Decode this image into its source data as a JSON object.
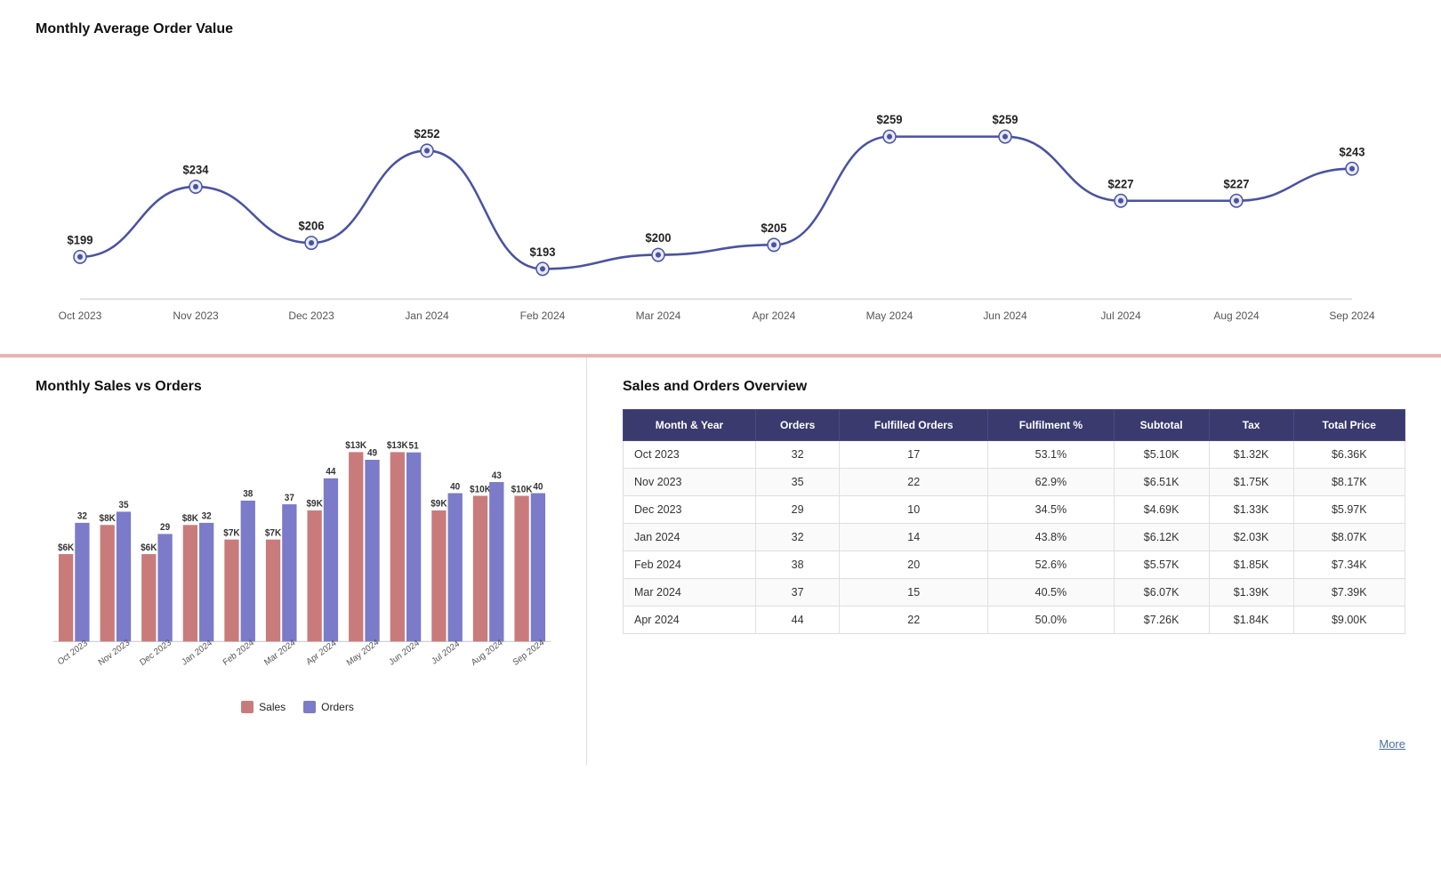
{
  "topChart": {
    "title": "Monthly Average Order Value",
    "data": [
      {
        "label": "Oct 2023",
        "value": 199
      },
      {
        "label": "Nov 2023",
        "value": 234
      },
      {
        "label": "Dec 2023",
        "value": 206
      },
      {
        "label": "Jan 2024",
        "value": 252
      },
      {
        "label": "Feb 2024",
        "value": 193
      },
      {
        "label": "Mar 2024",
        "value": 200
      },
      {
        "label": "Apr 2024",
        "value": 205
      },
      {
        "label": "May 2024",
        "value": 259
      },
      {
        "label": "Jun 2024",
        "value": 259
      },
      {
        "label": "Jul 2024",
        "value": 227
      },
      {
        "label": "Aug 2024",
        "value": 227
      },
      {
        "label": "Sep 2024",
        "value": 243
      }
    ]
  },
  "barChart": {
    "title": "Monthly Sales vs Orders",
    "legend": {
      "sales_label": "Sales",
      "orders_label": "Orders"
    },
    "data": [
      {
        "label": "Oct 2023",
        "sales": 6,
        "orders": 32
      },
      {
        "label": "Nov 2023",
        "sales": 8,
        "orders": 35
      },
      {
        "label": "Dec 2023",
        "sales": 6,
        "orders": 29
      },
      {
        "label": "Jan 2024",
        "sales": 8,
        "orders": 32
      },
      {
        "label": "Feb 2024",
        "sales": 7,
        "orders": 38
      },
      {
        "label": "Mar 2024",
        "sales": 7,
        "orders": 37
      },
      {
        "label": "Apr 2024",
        "sales": 9,
        "orders": 44
      },
      {
        "label": "May 2024",
        "sales": 13,
        "orders": 49
      },
      {
        "label": "Jun 2024",
        "sales": 13,
        "orders": 51
      },
      {
        "label": "Jul 2024",
        "sales": 9,
        "orders": 40
      },
      {
        "label": "Aug 2024",
        "sales": 10,
        "orders": 43
      },
      {
        "label": "Sep 2024",
        "sales": 10,
        "orders": 40
      }
    ]
  },
  "overviewTable": {
    "title": "Sales and Orders Overview",
    "columns": [
      "Month & Year",
      "Orders",
      "Fulfilled Orders",
      "Fulfilment %",
      "Subtotal",
      "Tax",
      "Total Price"
    ],
    "rows": [
      {
        "month": "Oct 2023",
        "orders": 32,
        "fulfilled": 17,
        "pct": "53.1%",
        "subtotal": "$5.10K",
        "tax": "$1.32K",
        "total": "$6.36K"
      },
      {
        "month": "Nov 2023",
        "orders": 35,
        "fulfilled": 22,
        "pct": "62.9%",
        "subtotal": "$6.51K",
        "tax": "$1.75K",
        "total": "$8.17K"
      },
      {
        "month": "Dec 2023",
        "orders": 29,
        "fulfilled": 10,
        "pct": "34.5%",
        "subtotal": "$4.69K",
        "tax": "$1.33K",
        "total": "$5.97K"
      },
      {
        "month": "Jan 2024",
        "orders": 32,
        "fulfilled": 14,
        "pct": "43.8%",
        "subtotal": "$6.12K",
        "tax": "$2.03K",
        "total": "$8.07K"
      },
      {
        "month": "Feb 2024",
        "orders": 38,
        "fulfilled": 20,
        "pct": "52.6%",
        "subtotal": "$5.57K",
        "tax": "$1.85K",
        "total": "$7.34K"
      },
      {
        "month": "Mar 2024",
        "orders": 37,
        "fulfilled": 15,
        "pct": "40.5%",
        "subtotal": "$6.07K",
        "tax": "$1.39K",
        "total": "$7.39K"
      },
      {
        "month": "Apr 2024",
        "orders": 44,
        "fulfilled": 22,
        "pct": "50.0%",
        "subtotal": "$7.26K",
        "tax": "$1.84K",
        "total": "$9.00K"
      }
    ]
  },
  "more_label": "More",
  "colors": {
    "line": "#4a52a3",
    "bar_sales": "#c97b7b",
    "bar_orders": "#7b7bc9",
    "table_header": "#3a3a6e"
  }
}
